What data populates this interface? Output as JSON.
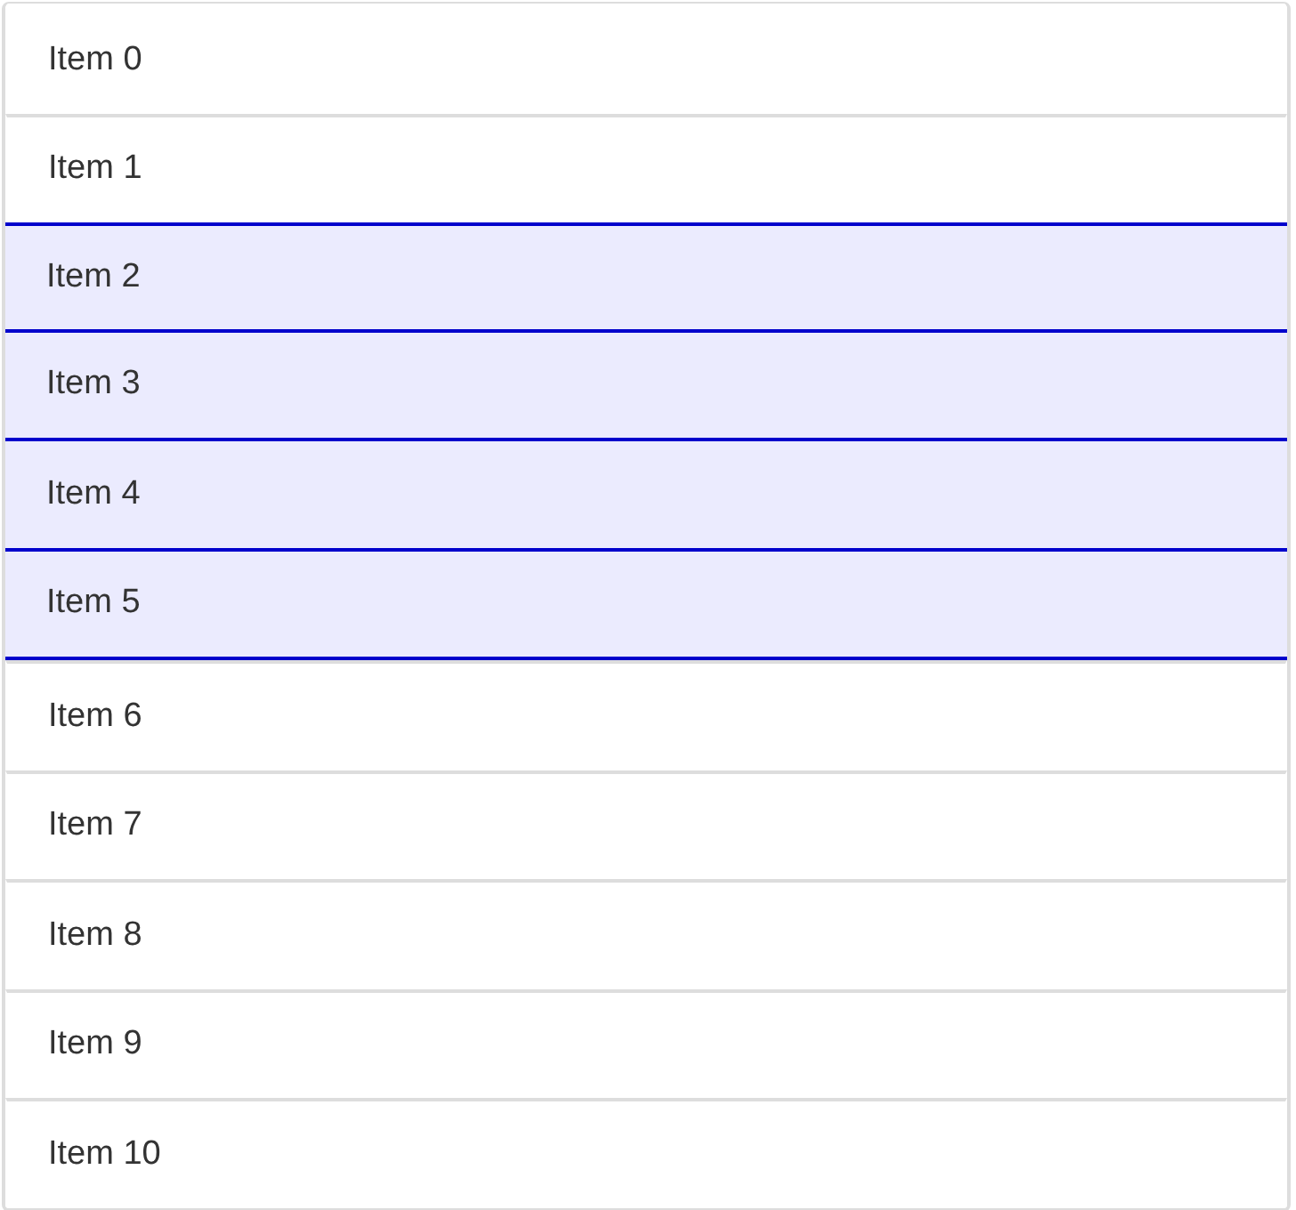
{
  "list": {
    "items": [
      {
        "label": "Item 0",
        "selected": false
      },
      {
        "label": "Item 1",
        "selected": false
      },
      {
        "label": "Item 2",
        "selected": true
      },
      {
        "label": "Item 3",
        "selected": true
      },
      {
        "label": "Item 4",
        "selected": true
      },
      {
        "label": "Item 5",
        "selected": true
      },
      {
        "label": "Item 6",
        "selected": false
      },
      {
        "label": "Item 7",
        "selected": false
      },
      {
        "label": "Item 8",
        "selected": false
      },
      {
        "label": "Item 9",
        "selected": false
      },
      {
        "label": "Item 10",
        "selected": false
      }
    ]
  }
}
